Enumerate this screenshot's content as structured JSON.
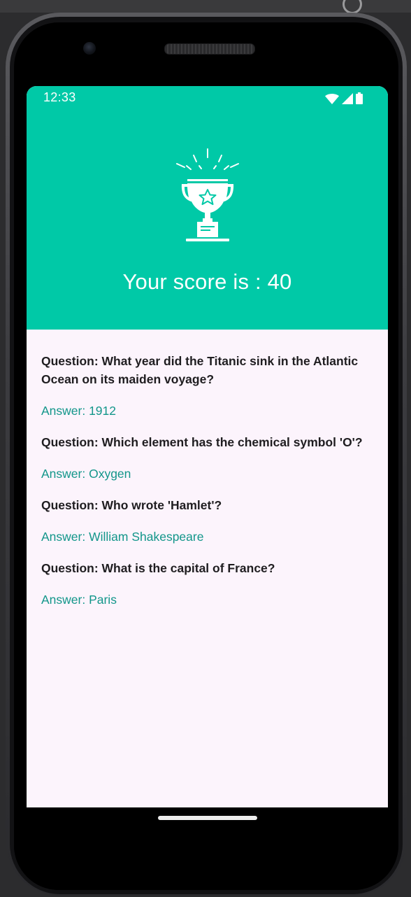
{
  "status_bar": {
    "time": "12:33",
    "icons": [
      "wifi-icon",
      "cellular-signal-icon",
      "battery-icon"
    ]
  },
  "header": {
    "icon": "trophy-icon",
    "score_text": "Your score is : 40",
    "background_color": "#00c9a7"
  },
  "results": [
    {
      "question": "Question: What year did the Titanic sink in the Atlantic Ocean on its maiden voyage?",
      "answer": "Answer: 1912"
    },
    {
      "question": "Question: Which element has the chemical symbol 'O'?",
      "answer": "Answer: Oxygen"
    },
    {
      "question": "Question: Who wrote 'Hamlet'?",
      "answer": "Answer: William Shakespeare"
    },
    {
      "question": "Question: What is the capital of France?",
      "answer": "Answer: Paris"
    }
  ],
  "colors": {
    "accent": "#00c9a7",
    "answer_text": "#12968a",
    "question_text": "#1f1d20",
    "screen_background": "#fcf4fc"
  }
}
